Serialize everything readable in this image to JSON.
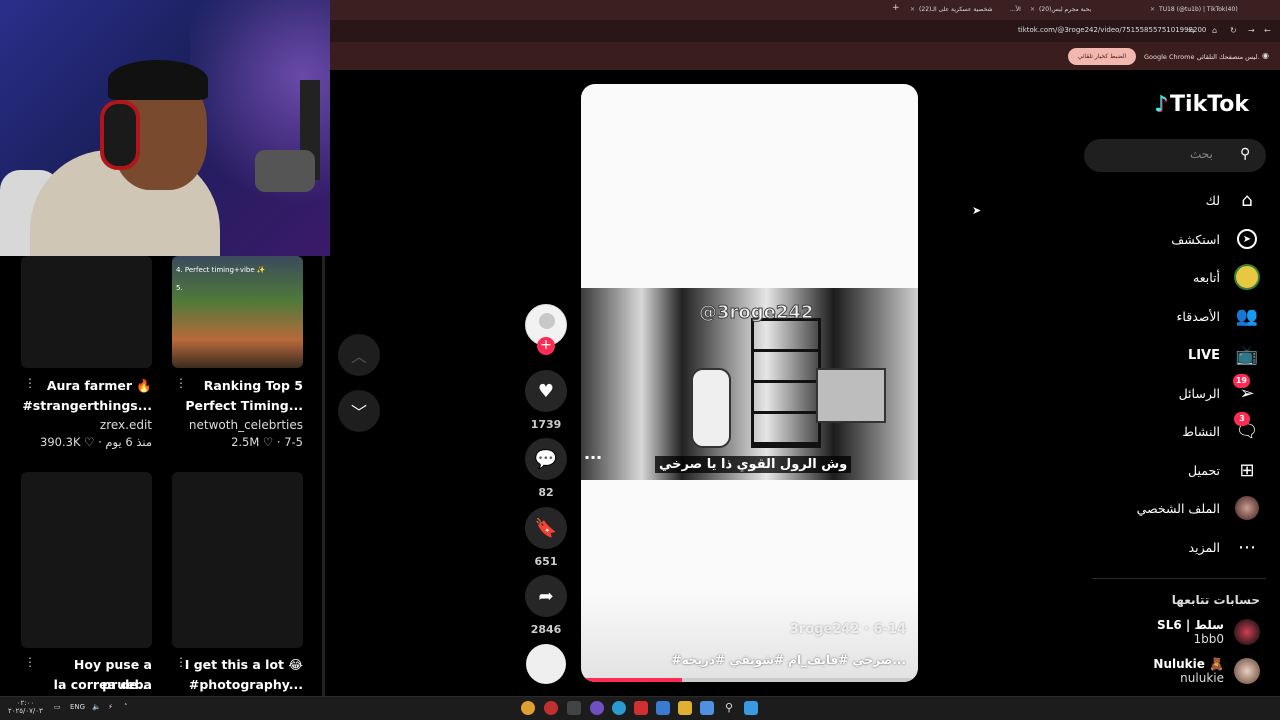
{
  "browser": {
    "tabs": [
      {
        "title": "TU18 (@tu1b) | TikTok(40)"
      },
      {
        "title": "(20)بحبة مجرم ليس"
      },
      {
        "title": "...الأ"
      },
      {
        "title": "(22)شخصية عسكرية على الـ"
      }
    ],
    "new_tab": "+",
    "url": "tiktok.com/@3roge242/video/7515585575101992200",
    "infobar_text": "Google Chrome ليس متصفحك التلقائي.",
    "infobar_button": "الضبط كخيار تلقائي"
  },
  "feed": {
    "cards": [
      {
        "title_line1": "Aura farmer 🔥",
        "title_line2": "#strangerthings...",
        "author": "zrex.edit",
        "stats": "390.3K ♡ · منذ 6 يوم"
      },
      {
        "title_line1": "Ranking Top 5",
        "title_line2": "Perfect Timing...",
        "author": "netwoth_celebrties",
        "stats": "2.5M ♡ · 7-5",
        "thumb_caption1": "4. Perfect timing+vibe ✨",
        "thumb_caption2": "5."
      },
      {
        "title_line1": "Hoy puse a prueba",
        "title_line2": "la correa de...",
        "author": "",
        "stats": ""
      },
      {
        "title_line1": "I get this a lot 😂",
        "title_line2": "#photography...",
        "author": "",
        "stats": ""
      }
    ]
  },
  "video": {
    "watermark": "@3roge242",
    "subtitle": "وش الرول القوي ذا يا صرخي",
    "meta": "3roge242 · 6-14",
    "description": "#صرخي #فايف_ام #شونقي #دريحه...",
    "progress": 0.3,
    "likes": "1739",
    "comments": "82",
    "saves": "651",
    "shares": "2846"
  },
  "sidebar": {
    "logo": "TikTok",
    "search_placeholder": "بحث",
    "items": [
      {
        "label": "لك",
        "icon": "home-icon"
      },
      {
        "label": "استكشف",
        "icon": "compass-icon"
      },
      {
        "label": "أتابعه",
        "icon": "following-icon"
      },
      {
        "label": "الأصدقاء",
        "icon": "friends-icon"
      },
      {
        "label": "LIVE",
        "icon": "live-icon"
      },
      {
        "label": "الرسائل",
        "icon": "messages-icon",
        "badge": "19"
      },
      {
        "label": "النشاط",
        "icon": "activity-icon",
        "badge": "3"
      },
      {
        "label": "تحميل",
        "icon": "upload-icon"
      },
      {
        "label": "الملف الشخصي",
        "icon": "profile-icon"
      },
      {
        "label": "المزيد",
        "icon": "more-icon"
      }
    ],
    "following_title": "حسابات تتابعها",
    "accounts": [
      {
        "name": "SL6 | سلط",
        "handle": "1bb0"
      },
      {
        "name": "Nulukie 🧸",
        "handle": "nulukie"
      }
    ]
  },
  "taskbar": {
    "lang": "ENG",
    "clock_time": "٠٢:٠٠",
    "clock_date": "٢٠٢٥/٠٧/٠٣"
  },
  "colors": {
    "accent": "#fe2c55",
    "cyan": "#25f4ee"
  }
}
